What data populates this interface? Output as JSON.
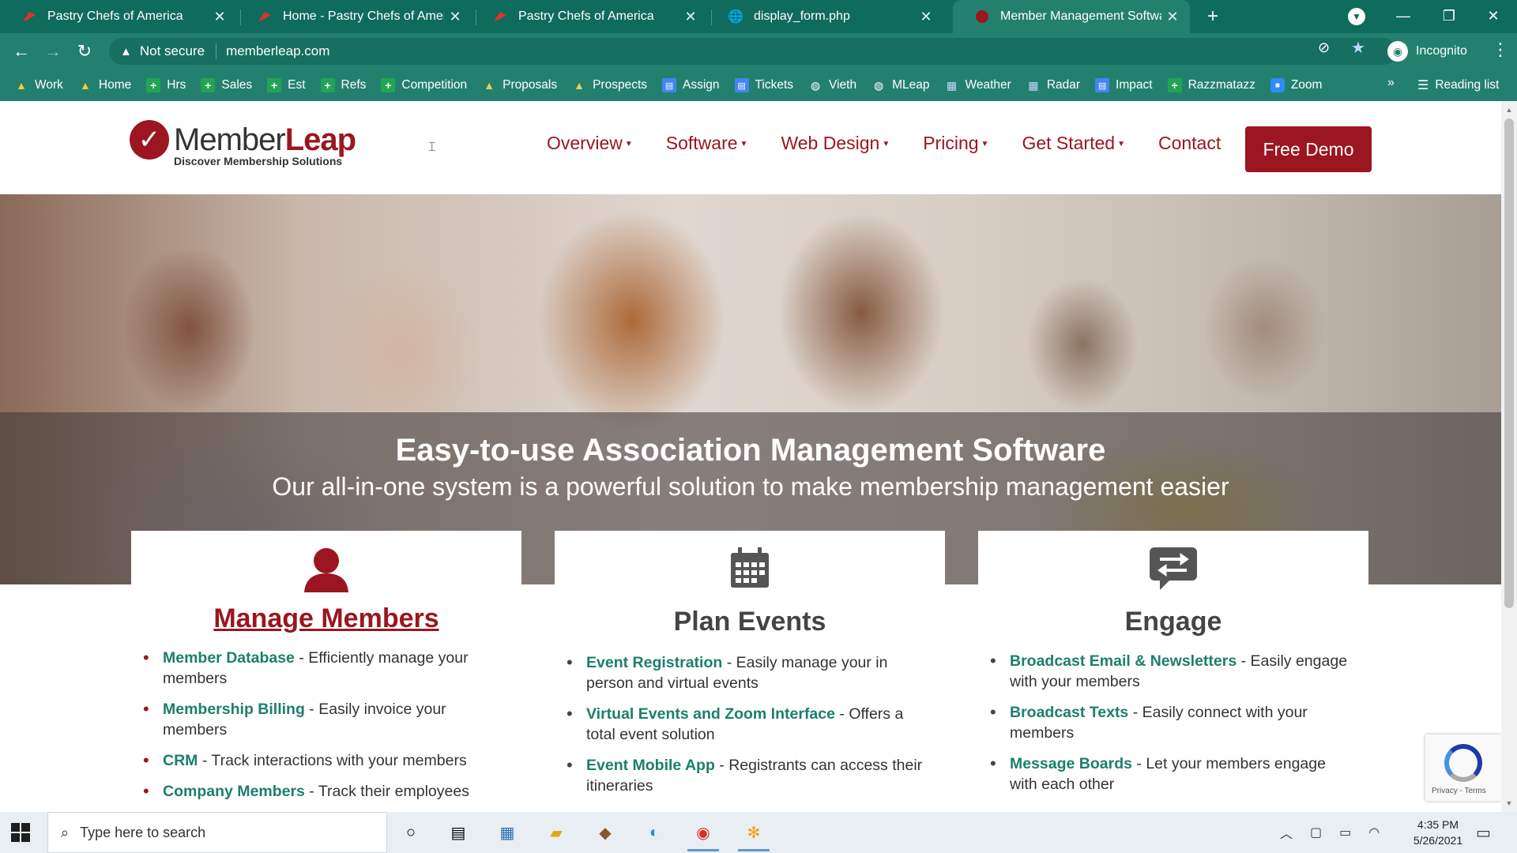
{
  "browser": {
    "tabs": [
      {
        "title": "Pastry Chefs of America",
        "active": false
      },
      {
        "title": "Home - Pastry Chefs of America",
        "active": false
      },
      {
        "title": "Pastry Chefs of America",
        "active": false
      },
      {
        "title": "display_form.php",
        "active": false
      },
      {
        "title": "Member Management Software",
        "active": true
      }
    ],
    "security_label": "Not secure",
    "url": "memberleap.com",
    "profile": "Incognito",
    "bookmarks": [
      {
        "label": "Work",
        "icon": "drive"
      },
      {
        "label": "Home",
        "icon": "drive"
      },
      {
        "label": "Hrs",
        "icon": "plus"
      },
      {
        "label": "Sales",
        "icon": "plus"
      },
      {
        "label": "Est",
        "icon": "plus"
      },
      {
        "label": "Refs",
        "icon": "plus"
      },
      {
        "label": "Competition",
        "icon": "plus"
      },
      {
        "label": "Proposals",
        "icon": "drive"
      },
      {
        "label": "Prospects",
        "icon": "drive"
      },
      {
        "label": "Assign",
        "icon": "doc"
      },
      {
        "label": "Tickets",
        "icon": "doc"
      },
      {
        "label": "Vieth",
        "icon": "globe"
      },
      {
        "label": "MLeap",
        "icon": "globe"
      },
      {
        "label": "Weather",
        "icon": "weather"
      },
      {
        "label": "Radar",
        "icon": "weather"
      },
      {
        "label": "Impact",
        "icon": "doc"
      },
      {
        "label": "Razzmatazz",
        "icon": "plus"
      },
      {
        "label": "Zoom",
        "icon": "zoom"
      }
    ],
    "reading_list": "Reading list"
  },
  "site": {
    "logo": {
      "word_a": "Member",
      "word_b": "Leap",
      "tagline": "Discover Membership Solutions"
    },
    "nav": [
      {
        "label": "Overview",
        "dropdown": true
      },
      {
        "label": "Software",
        "dropdown": true
      },
      {
        "label": "Web Design",
        "dropdown": true
      },
      {
        "label": "Pricing",
        "dropdown": true
      },
      {
        "label": "Get Started",
        "dropdown": true
      },
      {
        "label": "Contact",
        "dropdown": false
      }
    ],
    "cta": "Free Demo",
    "hero": {
      "title": "Easy-to-use Association Management Software",
      "subtitle": "Our all-in-one system is a powerful solution to make membership management easier"
    },
    "cards": [
      {
        "title": "Manage Members",
        "icon": "user-icon",
        "items": [
          {
            "term": "Member Database",
            "desc": " - Efficiently manage your members"
          },
          {
            "term": "Membership Billing",
            "desc": " - Easily invoice your members"
          },
          {
            "term": "CRM",
            "desc": " - Track interactions with your members"
          },
          {
            "term": "Company Members",
            "desc": " - Track their employees"
          }
        ]
      },
      {
        "title": "Plan Events",
        "icon": "calendar-icon",
        "items": [
          {
            "term": "Event Registration",
            "desc": " - Easily manage your in person and virtual events"
          },
          {
            "term": "Virtual Events and Zoom Interface",
            "desc": " - Offers a total event solution"
          },
          {
            "term": "Event Mobile App",
            "desc": " - Registrants can access their itineraries"
          }
        ]
      },
      {
        "title": "Engage",
        "icon": "exchange-icon",
        "items": [
          {
            "term": "Broadcast Email & Newsletters",
            "desc": " - Easily engage with your members"
          },
          {
            "term": "Broadcast Texts",
            "desc": " - Easily connect with your members"
          },
          {
            "term": "Message Boards",
            "desc": " - Let your members engage with each other"
          }
        ]
      }
    ],
    "recaptcha": "Privacy - Terms"
  },
  "taskbar": {
    "search_placeholder": "Type here to search",
    "time": "4:35 PM",
    "date": "5/26/2021"
  },
  "colors": {
    "brand": "#9b1620",
    "link": "#1c7f6c",
    "chrome": "#23806f"
  }
}
